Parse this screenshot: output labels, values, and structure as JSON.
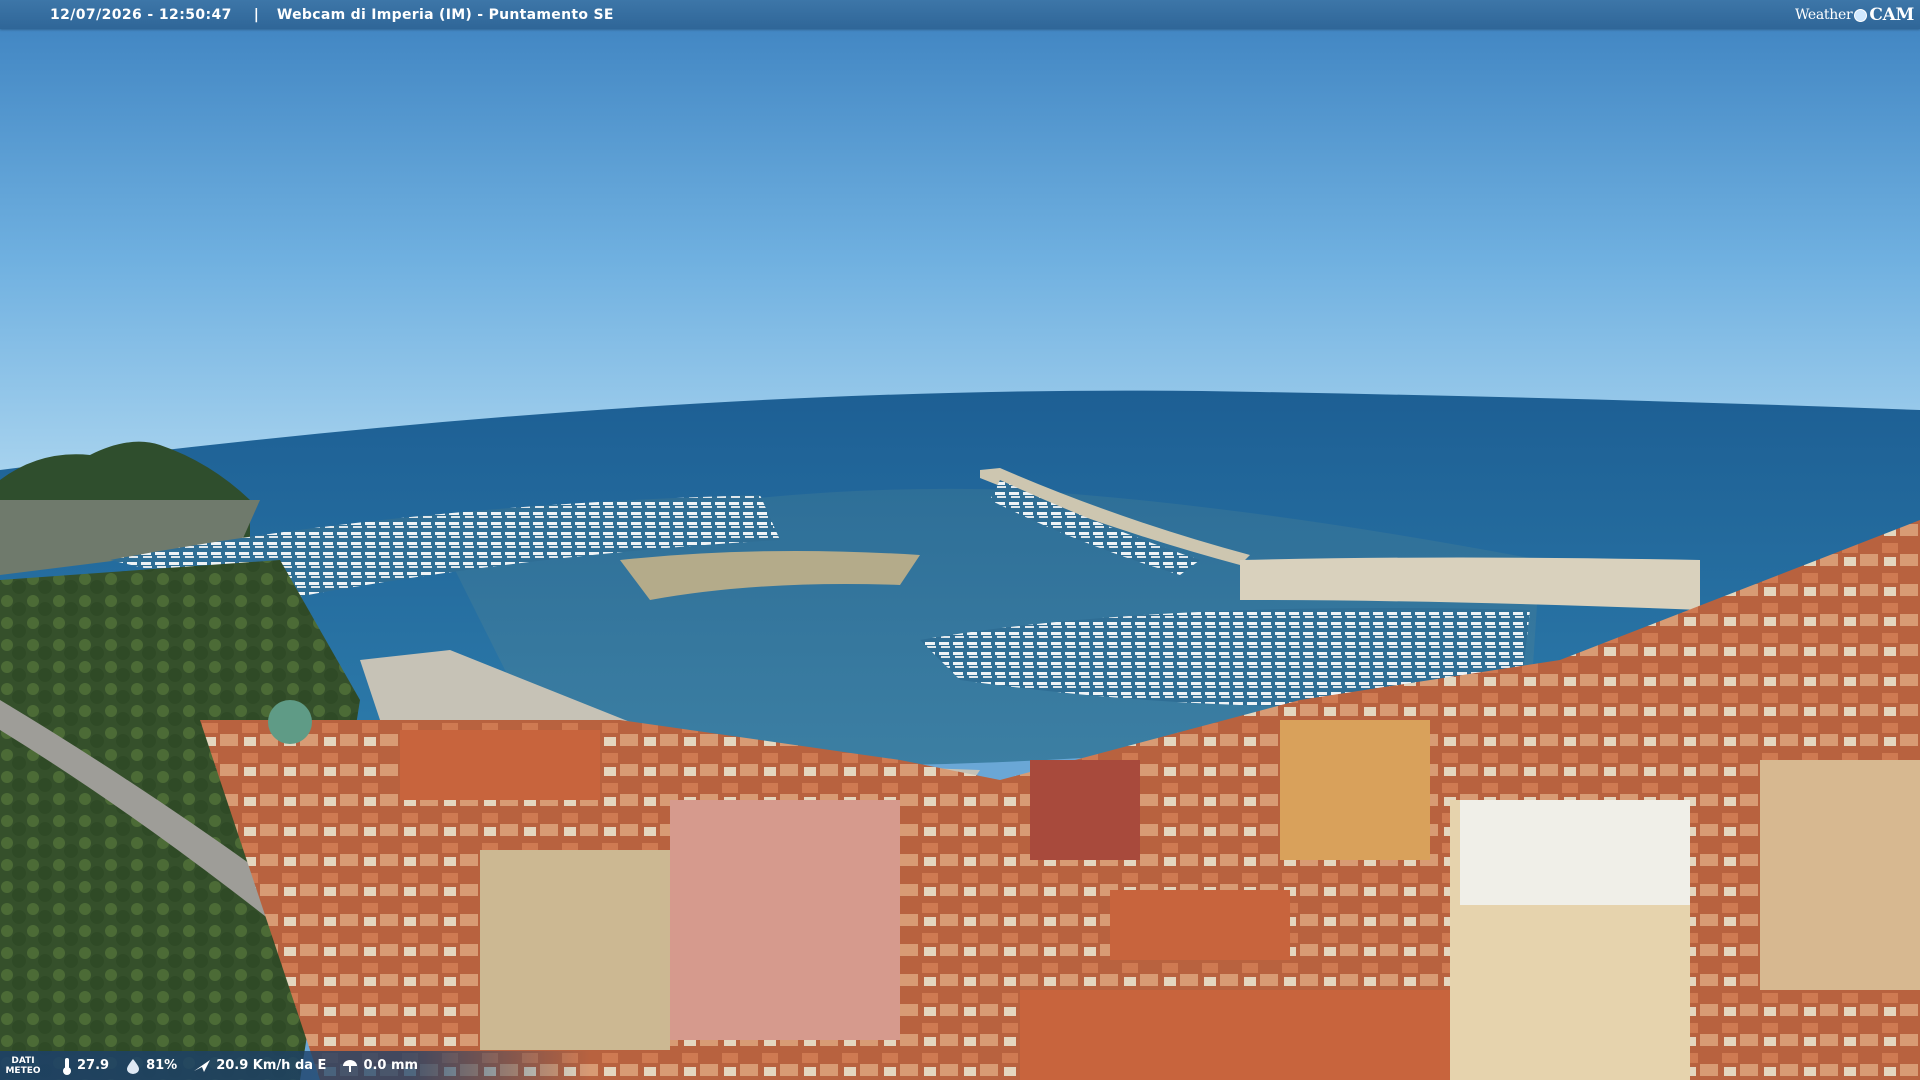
{
  "topbar": {
    "timestamp": "12/07/2026 - 12:50:47",
    "separator": "|",
    "title": "Webcam di Imperia (IM) - Puntamento SE"
  },
  "logo": {
    "left": "Weather",
    "right": "CAM"
  },
  "weather": {
    "label_line1": "DATI",
    "label_line2": "METEO",
    "temperature": "27.9",
    "humidity": "81%",
    "wind": "20.9 Km/h da E",
    "rain": "0.0 mm",
    "icons": [
      "thermometer-icon",
      "humidity-icon",
      "wind-icon",
      "rain-icon"
    ]
  },
  "colors": {
    "sky_top": "#3f86c4",
    "sky_horizon": "#8ec3e8",
    "sea": "#1f6a9b",
    "roof": "#c8643d",
    "bar": "#2f6698"
  }
}
